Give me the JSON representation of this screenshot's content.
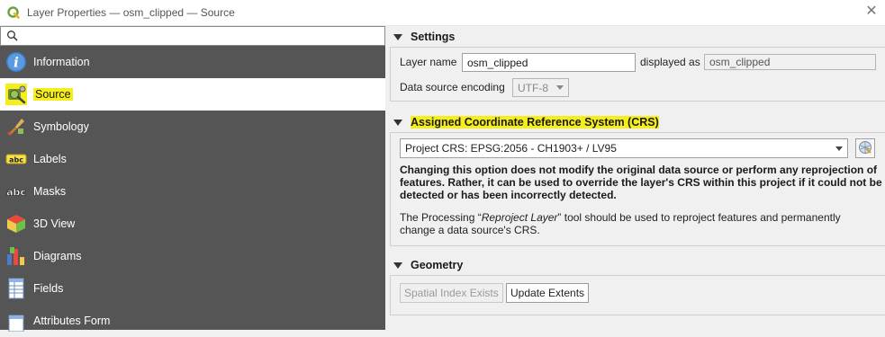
{
  "window": {
    "title": "Layer Properties — osm_clipped — Source",
    "app_icon": "qgis-logo-icon",
    "close_icon": "close-icon"
  },
  "search": {
    "value": "",
    "placeholder": ""
  },
  "sidebar": {
    "items": [
      {
        "label": "Information",
        "icon": "information-icon",
        "active": false
      },
      {
        "label": "Source",
        "icon": "source-icon",
        "active": true
      },
      {
        "label": "Symbology",
        "icon": "symbology-icon",
        "active": false
      },
      {
        "label": "Labels",
        "icon": "labels-icon",
        "active": false
      },
      {
        "label": "Masks",
        "icon": "masks-icon",
        "active": false
      },
      {
        "label": "3D View",
        "icon": "3d-view-icon",
        "active": false
      },
      {
        "label": "Diagrams",
        "icon": "diagrams-icon",
        "active": false
      },
      {
        "label": "Fields",
        "icon": "fields-icon",
        "active": false
      },
      {
        "label": "Attributes Form",
        "icon": "attributes-form-icon",
        "active": false
      }
    ]
  },
  "settings": {
    "title": "Settings",
    "layer_name_label": "Layer name",
    "layer_name_value": "osm_clipped",
    "displayed_as_label": "displayed as",
    "displayed_as_value": "osm_clipped",
    "encoding_label": "Data source encoding",
    "encoding_value": "UTF-8"
  },
  "crs": {
    "title": "Assigned Coordinate Reference System (CRS)",
    "selected": "Project CRS: EPSG:2056 - CH1903+ / LV95",
    "warning": "Changing this option does not modify the original data source or perform any reprojection of features. Rather, it can be used to override the layer's CRS within this project if it could not be detected or has been incorrectly detected.",
    "note_prefix": "The Processing “",
    "note_tool": "Reproject Layer",
    "note_suffix": "” tool should be used to reproject features and permanently change a data source's CRS."
  },
  "geometry": {
    "title": "Geometry",
    "spatial_index_label": "Spatial Index Exists",
    "update_extents_label": "Update Extents"
  },
  "colors": {
    "sidebar_bg": "#555555",
    "highlight": "#f5ee1a",
    "panel_bg": "#f0f0f0"
  }
}
